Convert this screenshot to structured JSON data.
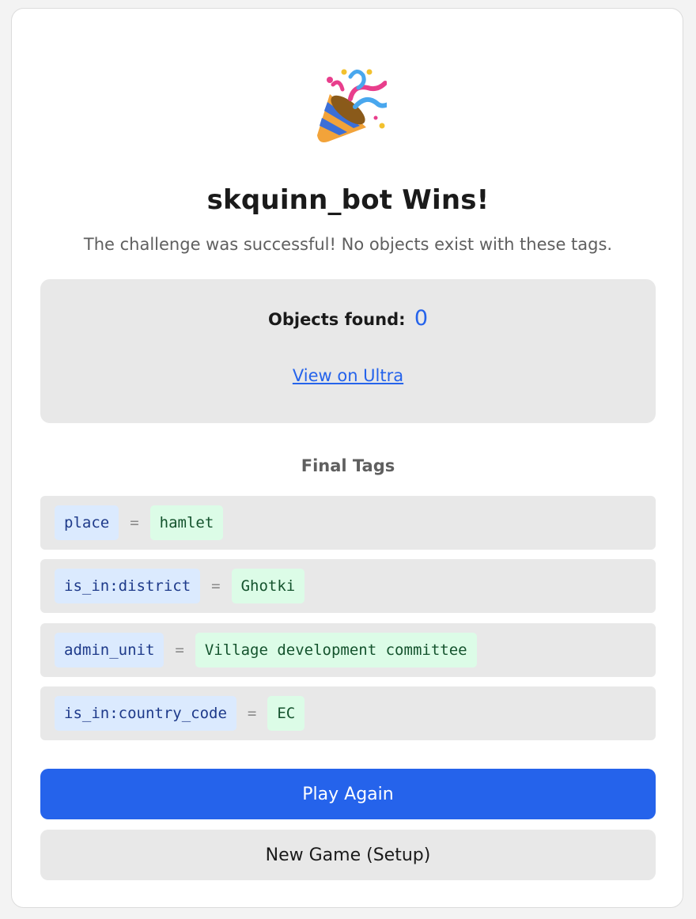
{
  "header": {
    "icon": "party-popper-icon",
    "title": "skquinn_bot Wins!",
    "subtitle": "The challenge was successful! No objects exist with these tags."
  },
  "result": {
    "objects_label": "Objects found:",
    "objects_count": "0",
    "link_label": "View on Ultra"
  },
  "tags": {
    "heading": "Final Tags",
    "separator": "=",
    "items": [
      {
        "key": "place",
        "value": "hamlet"
      },
      {
        "key": "is_in:district",
        "value": "Ghotki"
      },
      {
        "key": "admin_unit",
        "value": "Village development committee"
      },
      {
        "key": "is_in:country_code",
        "value": "EC"
      }
    ]
  },
  "actions": {
    "play_again": "Play Again",
    "new_game": "New Game (Setup)"
  },
  "colors": {
    "accent": "#2563eb",
    "key_bg": "#dbeafe",
    "value_bg": "#dcfce7",
    "panel_bg": "#e8e8e8"
  }
}
